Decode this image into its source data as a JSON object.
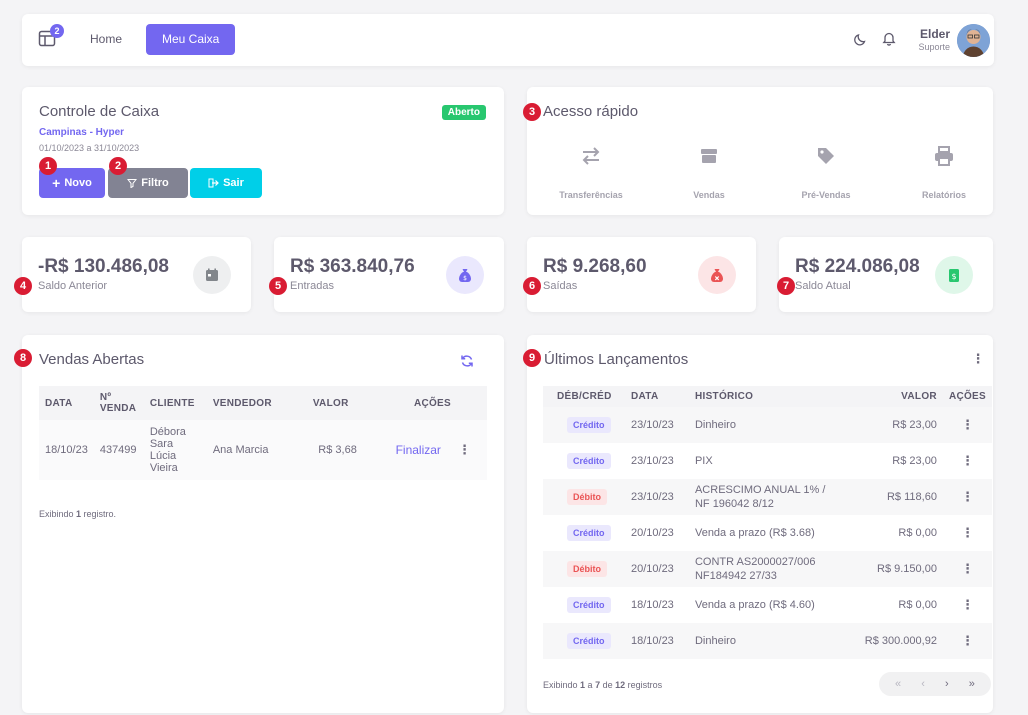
{
  "navbar": {
    "badge_count": "2",
    "home_label": "Home",
    "active_label": "Meu Caixa",
    "user_name": "Elder",
    "user_role": "Suporte"
  },
  "controle": {
    "title": "Controle de Caixa",
    "store": "Campinas - Hyper",
    "period": "01/10/2023 a 31/10/2023",
    "status": "Aberto",
    "btn_novo": "Novo",
    "btn_filtro": "Filtro",
    "btn_sair": "Sair"
  },
  "acesso": {
    "title": "Acesso rápido",
    "items": [
      {
        "label": "Transferências",
        "icon": "swap-arrows-icon"
      },
      {
        "label": "Vendas",
        "icon": "box-icon"
      },
      {
        "label": "Pré-Vendas",
        "icon": "tag-icon"
      },
      {
        "label": "Relatórios",
        "icon": "printer-icon"
      }
    ]
  },
  "stats": [
    {
      "value": "-R$ 130.486,08",
      "label": "Saldo Anterior",
      "icon": "calendar-icon",
      "color": "#82868b"
    },
    {
      "value": "R$ 363.840,76",
      "label": "Entradas",
      "icon": "money-bag-icon",
      "color": "#7367f0"
    },
    {
      "value": "R$ 9.268,60",
      "label": "Saídas",
      "icon": "money-bag-x-icon",
      "color": "#ea5455"
    },
    {
      "value": "R$ 224.086,08",
      "label": "Saldo Atual",
      "icon": "cash-icon",
      "color": "#28c76f"
    }
  ],
  "markers": [
    "1",
    "2",
    "3",
    "4",
    "5",
    "6",
    "7",
    "8",
    "9"
  ],
  "vendas": {
    "title": "Vendas Abertas",
    "headers": [
      "DATA",
      "Nº VENDA",
      "CLIENTE",
      "VENDEDOR",
      "VALOR",
      "AÇÕES"
    ],
    "rows": [
      {
        "data": "18/10/23",
        "venda": "437499",
        "cliente": "Débora Sara Lúcia Vieira",
        "vendedor": "Ana Marcia",
        "valor": "R$ 3,68",
        "acao": "Finalizar"
      }
    ],
    "footer_prefix": "Exibindo ",
    "footer_count": "1",
    "footer_suffix": " registro."
  },
  "lancamentos": {
    "title": "Últimos Lançamentos",
    "headers": [
      "DÉB/CRÉD",
      "DATA",
      "HISTÓRICO",
      "VALOR",
      "AÇÕES"
    ],
    "rows": [
      {
        "tipo": "Crédito",
        "data": "23/10/23",
        "historico": "Dinheiro",
        "valor": "R$ 23,00"
      },
      {
        "tipo": "Crédito",
        "data": "23/10/23",
        "historico": "PIX",
        "valor": "R$ 23,00"
      },
      {
        "tipo": "Débito",
        "data": "23/10/23",
        "historico": "ACRESCIMO ANUAL 1% / NF 196042 8/12",
        "valor": "R$ 118,60"
      },
      {
        "tipo": "Crédito",
        "data": "20/10/23",
        "historico": "Venda a prazo (R$ 3.68)",
        "valor": "R$ 0,00"
      },
      {
        "tipo": "Débito",
        "data": "20/10/23",
        "historico": "CONTR AS2000027/006 NF184942 27/33",
        "valor": "R$ 9.150,00"
      },
      {
        "tipo": "Crédito",
        "data": "18/10/23",
        "historico": "Venda a prazo (R$ 4.60)",
        "valor": "R$ 0,00"
      },
      {
        "tipo": "Crédito",
        "data": "18/10/23",
        "historico": "Dinheiro",
        "valor": "R$ 300.000,92"
      }
    ],
    "footer_prefix": "Exibindo ",
    "footer_from": "1",
    "footer_mid1": " a ",
    "footer_to": "7",
    "footer_mid2": " de ",
    "footer_total": "12",
    "footer_suffix": " registros",
    "pager": [
      "«",
      "‹",
      "›",
      "»"
    ]
  }
}
